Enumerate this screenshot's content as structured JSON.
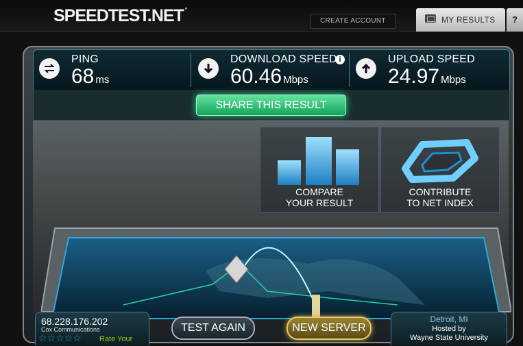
{
  "header": {
    "logo_text": "SPEEDTEST.NET",
    "logo_mark": "°",
    "create_account_label": "CREATE ACCOUNT",
    "my_results_label": "MY RESULTS",
    "help_label": "?"
  },
  "stats": {
    "ping": {
      "title": "PING",
      "value": "68",
      "unit": "ms",
      "icon": "two-way-arrow-icon"
    },
    "download": {
      "title": "DOWNLOAD SPEED",
      "value": "60.46",
      "unit": "Mbps",
      "icon": "down-arrow-icon",
      "info": "i"
    },
    "upload": {
      "title": "UPLOAD SPEED",
      "value": "24.97",
      "unit": "Mbps",
      "icon": "up-arrow-icon"
    }
  },
  "share_label": "SHARE THIS RESULT",
  "tiles": {
    "compare": {
      "line1": "COMPARE",
      "line2": "YOUR RESULT"
    },
    "contribute": {
      "line1": "CONTRIBUTE",
      "line2": "TO NET INDEX"
    }
  },
  "client": {
    "ip": "68.228.176.202",
    "isp": "Cox Communications",
    "stars": "☆☆☆☆☆",
    "rate_label": "Rate Your"
  },
  "server": {
    "city": "Detroit, MI",
    "hosted_label": "Hosted by",
    "host": "Wayne State University"
  },
  "buttons": {
    "test_again": "TEST AGAIN",
    "new_server": "NEW SERVER"
  },
  "colors": {
    "accent_green": "#2fd38a",
    "accent_blue": "#2d8ab0",
    "server_gold": "#c9a640"
  }
}
